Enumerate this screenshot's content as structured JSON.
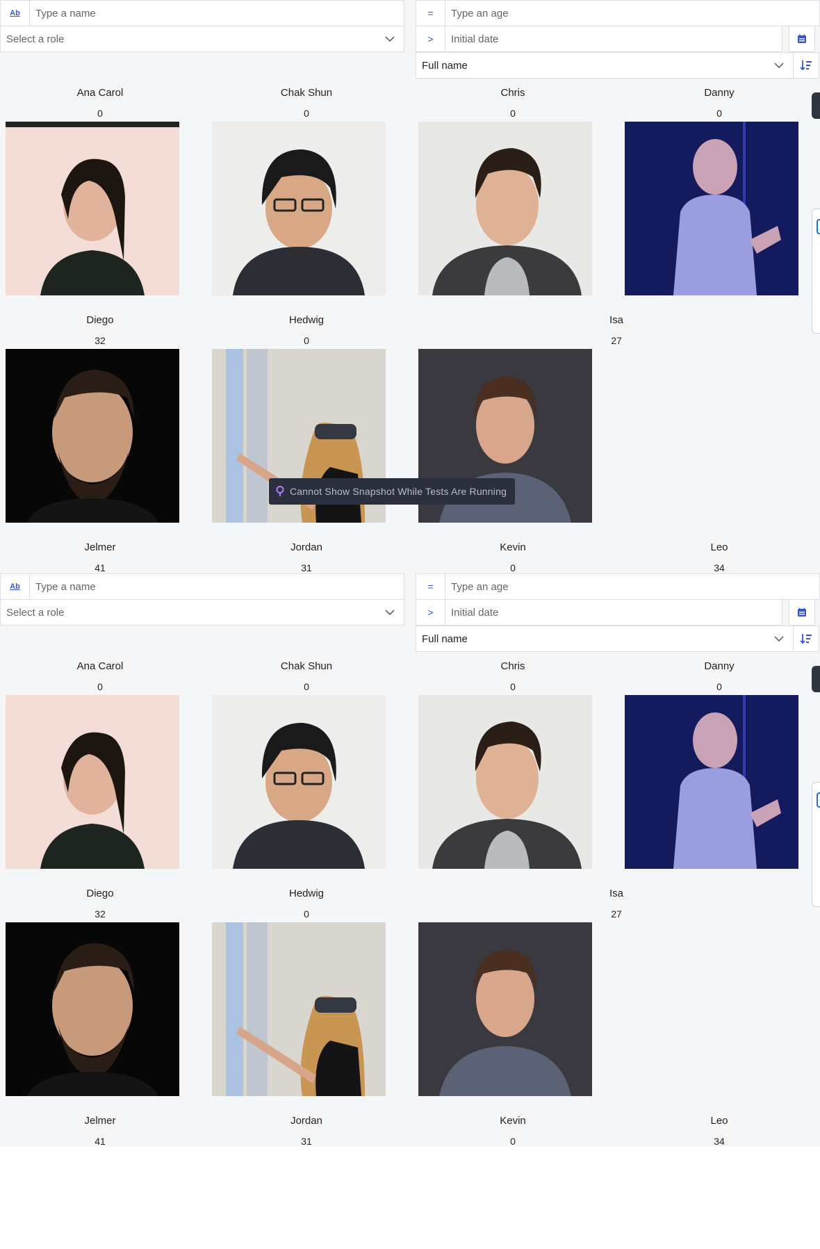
{
  "filters": {
    "name_placeholder": "Type a name",
    "name_prefix": "Ab",
    "age_placeholder": "Type an age",
    "age_operator": "=",
    "role_placeholder": "Select a role",
    "date_placeholder": "Initial date",
    "date_operator": ">",
    "sort_value": "Full name"
  },
  "people": [
    {
      "name": "Ana Carol",
      "age": "0",
      "photo": "ana"
    },
    {
      "name": "Chak Shun",
      "age": "0",
      "photo": "chak"
    },
    {
      "name": "Chris",
      "age": "0",
      "photo": "chris"
    },
    {
      "name": "Danny",
      "age": "0",
      "photo": "danny"
    },
    {
      "name": "Diego",
      "age": "32",
      "photo": "diego"
    },
    {
      "name": "Hedwig",
      "age": "0",
      "photo": "hedwig"
    },
    {
      "name": "",
      "age": "",
      "photo": "kevin"
    },
    {
      "name": "Isa",
      "age": "27",
      "photo": ""
    },
    {
      "name": "Jelmer",
      "age": "41",
      "photo": ""
    },
    {
      "name": "Jordan",
      "age": "31",
      "photo": ""
    },
    {
      "name": "Kevin",
      "age": "0",
      "photo": ""
    },
    {
      "name": "Leo",
      "age": "34",
      "photo": ""
    }
  ],
  "tooltip": {
    "text": "Cannot Show Snapshot While Tests Are Running",
    "icon": "pin-icon"
  },
  "colors": {
    "accent": "#3454d1",
    "tooltip_bg": "#2c2f3e"
  }
}
